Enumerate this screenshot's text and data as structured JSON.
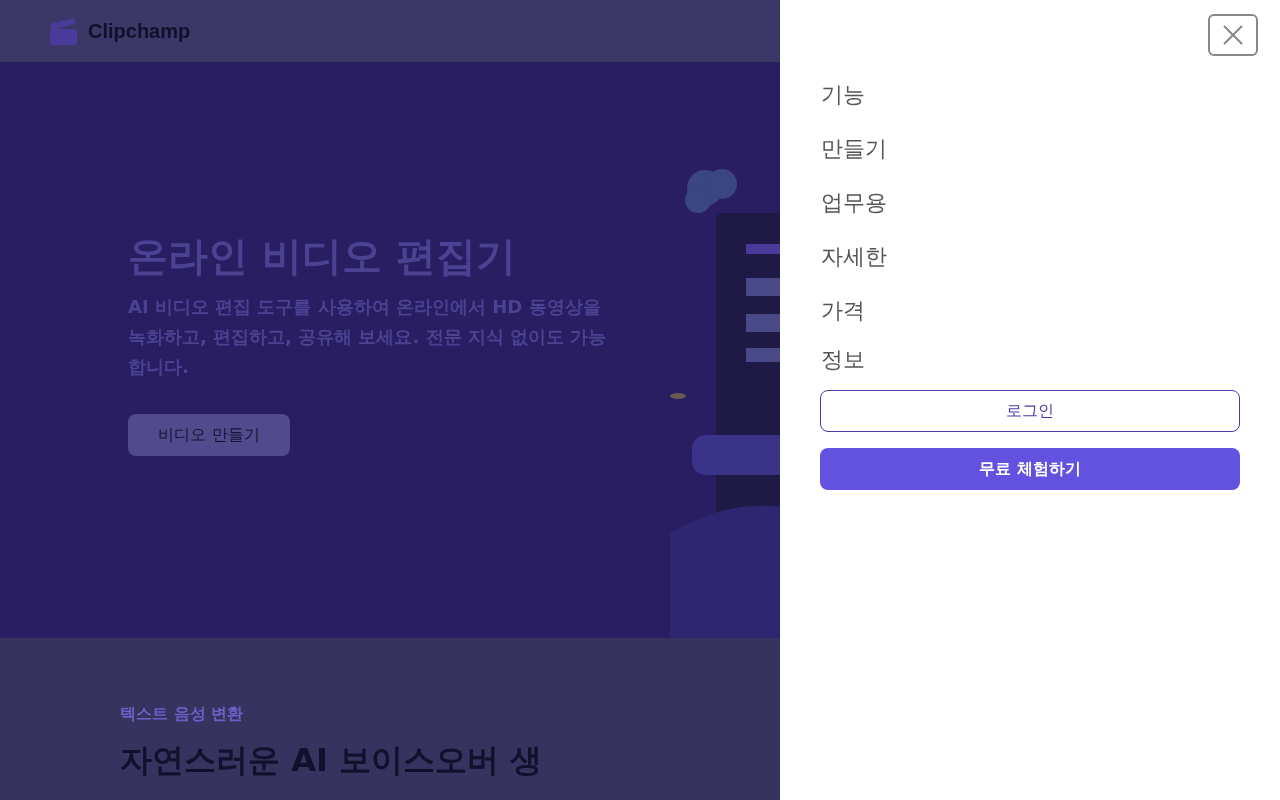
{
  "header": {
    "logo_text": "Clipchamp"
  },
  "hero": {
    "title": "온라인 비디오 편집기",
    "subtitle": "AI 비디오 편집 도구를 사용하여 온라인에서 HD 동영상을 녹화하고, 편집하고, 공유해 보세요. 전문 지식 없이도 가능합니다.",
    "button": "비디오 만들기"
  },
  "section": {
    "eyebrow": "텍스트 음성 변환",
    "heading": "자연스러운 AI 보이스오버 생"
  },
  "menu": {
    "items": [
      {
        "label": "기능"
      },
      {
        "label": "만들기"
      },
      {
        "label": "업무용"
      },
      {
        "label": "자세한"
      },
      {
        "label": "가격"
      },
      {
        "label": "정보"
      }
    ],
    "login": "로그인",
    "trial": "무료 체험하기"
  }
}
